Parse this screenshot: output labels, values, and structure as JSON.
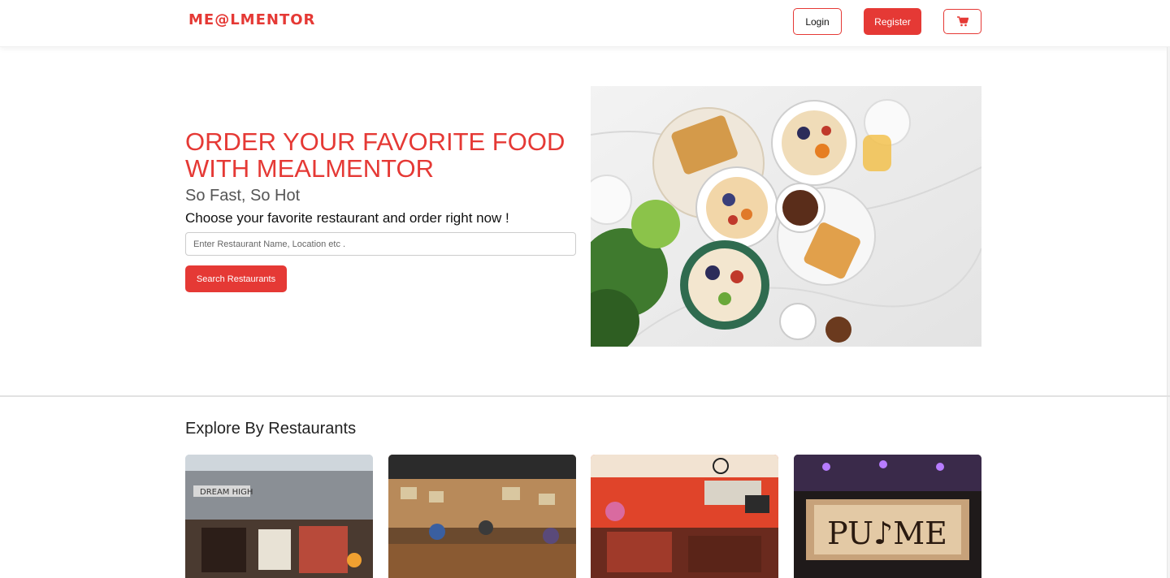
{
  "nav": {
    "logo": "ME@LMENTOR",
    "login_label": "Login",
    "register_label": "Register",
    "cart_icon": "cart-icon"
  },
  "hero": {
    "title": "ORDER YOUR FAVORITE FOOD WITH MEALMENTOR",
    "subtitle": "So Fast, So Hot",
    "tagline": "Choose your favorite restaurant and order right now !",
    "search_placeholder": "Enter Restaurant Name, Location etc .",
    "search_value": "",
    "search_button": "Search Restaurants"
  },
  "explore": {
    "heading": "Explore By Restaurants",
    "restaurants": [
      {
        "sign": "DREAM HIGH"
      },
      {
        "sign": ""
      },
      {
        "sign": ""
      },
      {
        "sign": "PU♪ME"
      }
    ]
  },
  "colors": {
    "accent": "#e53935"
  }
}
